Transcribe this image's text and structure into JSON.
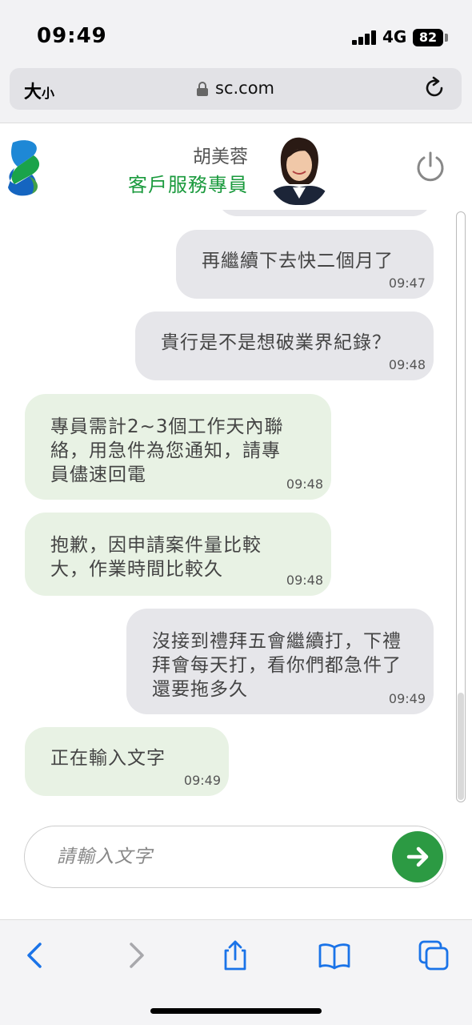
{
  "status_bar": {
    "time": "09:49",
    "network": "4G",
    "battery": "82"
  },
  "browser": {
    "text_size_label_big": "大",
    "text_size_label_small": "小",
    "domain": "sc.com"
  },
  "agent": {
    "name": "胡美蓉",
    "role": "客戶服務專員"
  },
  "messages": [
    {
      "sender": "user",
      "text": "再繼續下去快二個月了",
      "time": "09:47"
    },
    {
      "sender": "user",
      "text": "貴行是不是想破業界紀錄？",
      "time": "09:48"
    },
    {
      "sender": "agent",
      "text": "專員需計2~3個工作天內聯絡，用急件為您通知，請專員儘速回電",
      "time": "09:48"
    },
    {
      "sender": "agent",
      "text": "抱歉，因申請案件量比較大，作業時間比較久",
      "time": "09:48"
    },
    {
      "sender": "user",
      "text": "沒接到禮拜五會繼續打，下禮拜會每天打，看你們都急件了還要拖多久",
      "time": "09:49"
    },
    {
      "sender": "agent",
      "text": "正在輸入文字",
      "time": "09:49"
    }
  ],
  "composer": {
    "placeholder": "請輸入文字",
    "value": ""
  },
  "colors": {
    "brand_green": "#1a9a3d",
    "send_button": "#2c9a43",
    "agent_bubble": "#e8f2e4",
    "user_bubble": "#e6e6ea",
    "browser_blue": "#1a73e8"
  },
  "icons": [
    "standard-chartered-logo",
    "power-icon",
    "send-arrow-icon",
    "reload-icon",
    "lock-icon",
    "back-icon",
    "forward-icon",
    "share-icon",
    "bookmarks-icon",
    "tabs-icon"
  ]
}
